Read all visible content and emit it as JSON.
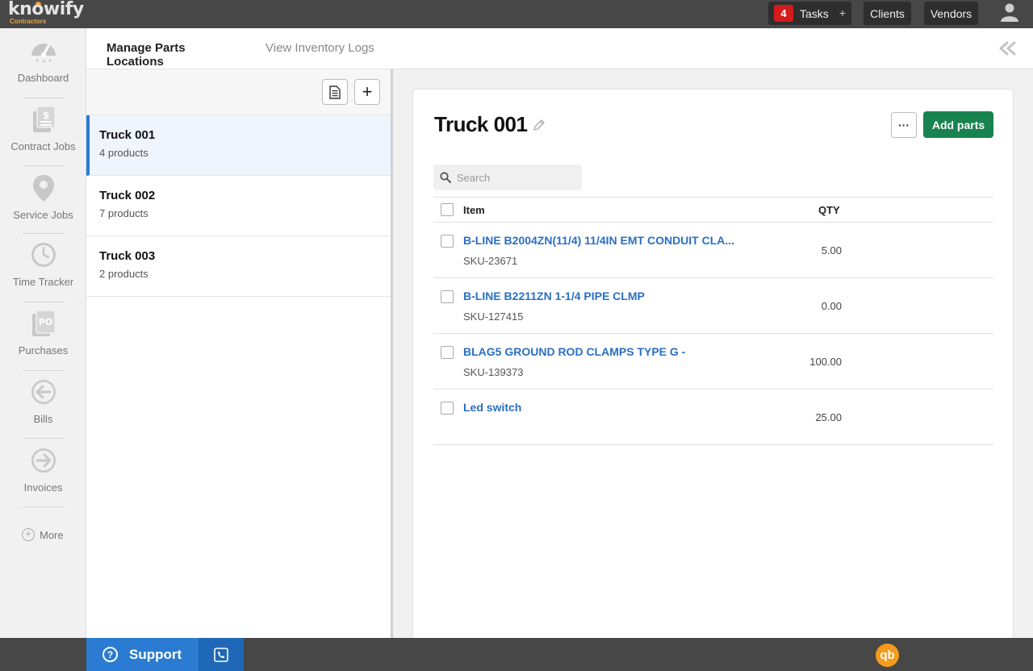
{
  "app": {
    "logo_text": "knowify",
    "logo_sub": "Contractors",
    "accent_color": "#2a7bd1",
    "primary_button_color": "#18834f"
  },
  "topbar": {
    "tasks_count": "4",
    "tasks_label": "Tasks",
    "tasks_add": "+",
    "clients_label": "Clients",
    "vendors_label": "Vendors",
    "user_icon": "user-icon"
  },
  "nav": {
    "items": [
      {
        "label": "Dashboard",
        "icon": "dashboard-icon"
      },
      {
        "label": "Contract Jobs",
        "icon": "contract-jobs-icon"
      },
      {
        "label": "Service Jobs",
        "icon": "location-pin-icon"
      },
      {
        "label": "Time Tracker",
        "icon": "clock-icon"
      },
      {
        "label": "Purchases",
        "icon": "po-icon",
        "icon_text": "PO"
      },
      {
        "label": "Bills",
        "icon": "arrow-left-circle-icon"
      },
      {
        "label": "Invoices",
        "icon": "arrow-right-circle-icon"
      }
    ],
    "more_label": "More"
  },
  "tabs": {
    "active": "Manage Parts Locations",
    "inactive": "View Inventory Logs"
  },
  "locations": {
    "add_label": "+",
    "items": [
      {
        "name": "Truck 001",
        "count": "4 products",
        "selected": true
      },
      {
        "name": "Truck 002",
        "count": "7 products",
        "selected": false
      },
      {
        "name": "Truck 003",
        "count": "2 products",
        "selected": false
      }
    ]
  },
  "detail": {
    "title": "Truck 001",
    "more_label": "···",
    "add_parts_label": "Add parts",
    "search_placeholder": "Search",
    "table": {
      "col_item": "Item",
      "col_qty": "QTY",
      "rows": [
        {
          "name": "B-LINE B2004ZN(11/4) 11/4IN EMT CONDUIT CLA...",
          "sku": "SKU-23671",
          "qty": "5.00"
        },
        {
          "name": "B-LINE B2211ZN 1-1/4 PIPE CLMP",
          "sku": "SKU-127415",
          "qty": "0.00"
        },
        {
          "name": "BLAG5 GROUND ROD CLAMPS TYPE G -",
          "sku": "SKU-139373",
          "qty": "100.00"
        },
        {
          "name": "Led switch",
          "sku": "",
          "qty": "25.00"
        }
      ]
    }
  },
  "bottombar": {
    "support_label": "Support",
    "support_icon": "question-circle-icon",
    "phone_icon": "phone-icon",
    "qb_label": "qb"
  }
}
